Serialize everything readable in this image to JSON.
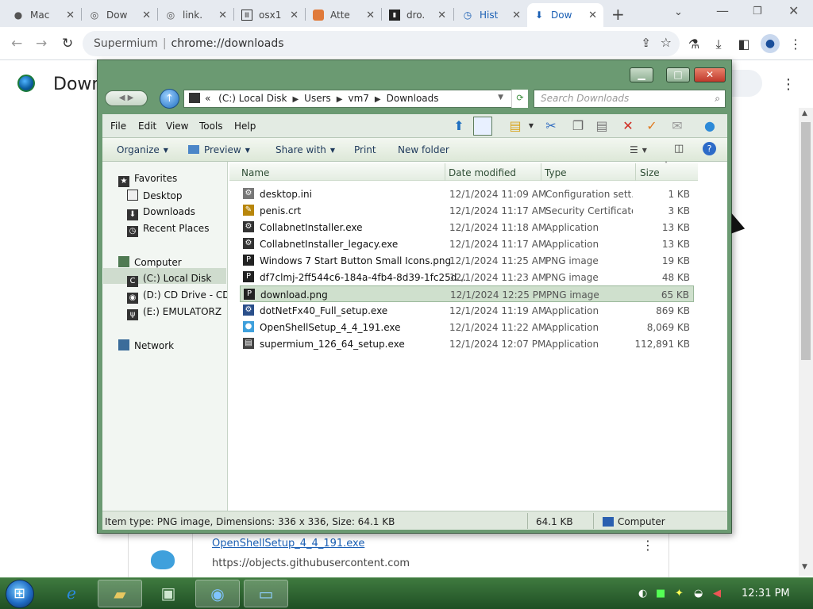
{
  "browser": {
    "tabs": [
      {
        "title": "Mac",
        "icon": "apple-icon"
      },
      {
        "title": "Dow",
        "icon": "globe-icon"
      },
      {
        "title": "link.",
        "icon": "link-icon"
      },
      {
        "title": "osx1",
        "icon": "archive-icon"
      },
      {
        "title": "Atte",
        "icon": "colored-icon"
      },
      {
        "title": "dro.",
        "icon": "terminal-icon"
      },
      {
        "title": "Hist",
        "icon": "history-icon"
      },
      {
        "title": "Dow",
        "icon": "download-icon",
        "active": true
      }
    ],
    "new_tab": "+",
    "tab_menu": "⌄",
    "window_controls": {
      "minimize": "—",
      "restore": "❐",
      "close": "✕"
    },
    "omnibox": {
      "site": "Supermium",
      "url": "chrome://downloads"
    },
    "nav": {
      "back": "←",
      "forward": "→",
      "reload": "↻"
    }
  },
  "downloads_page": {
    "title": "Down",
    "menu": "⋮",
    "card": {
      "link": "OpenShellSetup_4_4_191.exe",
      "url": "https://objects.githubusercontent.com",
      "menu": "⋮"
    }
  },
  "explorer": {
    "caption_buttons": {
      "minimize": "▁",
      "maximize": "□",
      "close": "✕"
    },
    "back_forward": "◀ ▶",
    "up_glyph": "↑",
    "address": {
      "overflow": "«",
      "crumbs": [
        "(C:) Local Disk",
        "Users",
        "vm7",
        "Downloads"
      ],
      "sep": "▶",
      "dropdown": "▼",
      "refresh": "⟳"
    },
    "search": {
      "placeholder": "Search Downloads",
      "icon": "🔍"
    },
    "menu": [
      "File",
      "Edit",
      "View",
      "Tools",
      "Help"
    ],
    "commands": [
      {
        "label": "Organize",
        "dropdown": true
      },
      {
        "label": "Preview",
        "dropdown": true
      },
      {
        "label": "Share with",
        "dropdown": true
      },
      {
        "label": "Print",
        "dropdown": false
      },
      {
        "label": "New folder",
        "dropdown": false
      }
    ],
    "dropdown_glyph": "▼",
    "nav": {
      "favorites": "Favorites",
      "favorites_items": [
        "Desktop",
        "Downloads",
        "Recent Places"
      ],
      "computer": "Computer",
      "computer_items": [
        "(C:) Local Disk",
        "(D:) CD Drive - CDRC",
        "(E:) EMULATORZ"
      ],
      "network": "Network"
    },
    "columns": {
      "name": "Name",
      "date": "Date modified",
      "type": "Type",
      "size": "Size"
    },
    "sort_arrow": "˄",
    "files": [
      {
        "name": "desktop.ini",
        "date": "12/1/2024 11:09 AM",
        "type": "Configuration sett...",
        "size": "1 KB",
        "icon": "settings-file-icon"
      },
      {
        "name": "penis.crt",
        "date": "12/1/2024 11:17 AM",
        "type": "Security Certificate",
        "size": "3 KB",
        "icon": "certificate-icon"
      },
      {
        "name": "CollabnetInstaller.exe",
        "date": "12/1/2024 11:18 AM",
        "type": "Application",
        "size": "13 KB",
        "icon": "application-icon"
      },
      {
        "name": "CollabnetInstaller_legacy.exe",
        "date": "12/1/2024 11:17 AM",
        "type": "Application",
        "size": "13 KB",
        "icon": "application-icon"
      },
      {
        "name": "Windows 7 Start Button Small Icons.png",
        "date": "12/1/2024 11:25 AM",
        "type": "PNG image",
        "size": "19 KB",
        "icon": "png-icon"
      },
      {
        "name": "df7clmj-2ff544c6-184a-4fb4-8d39-1fc25d...",
        "date": "12/1/2024 11:23 AM",
        "type": "PNG image",
        "size": "48 KB",
        "icon": "png-icon"
      },
      {
        "name": "download.png",
        "date": "12/1/2024 12:25 PM",
        "type": "PNG image",
        "size": "65 KB",
        "icon": "png-icon",
        "selected": true
      },
      {
        "name": "dotNetFx40_Full_setup.exe",
        "date": "12/1/2024 11:19 AM",
        "type": "Application",
        "size": "869 KB",
        "icon": "installer-icon"
      },
      {
        "name": "OpenShellSetup_4_4_191.exe",
        "date": "12/1/2024 11:22 AM",
        "type": "Application",
        "size": "8,069 KB",
        "icon": "shell-icon"
      },
      {
        "name": "supermium_126_64_setup.exe",
        "date": "12/1/2024 12:07 PM",
        "type": "Application",
        "size": "112,891 KB",
        "icon": "setup-icon"
      }
    ],
    "status": {
      "details": "Item type: PNG image, Dimensions: 336 x 336, Size: 64.1 KB",
      "size": "64.1 KB",
      "location": "Computer"
    }
  },
  "taskbar": {
    "clock": "12:31 PM",
    "start_glyph": "⊞"
  },
  "colors": {
    "explorer_frame": "#6b9a72",
    "selection": "#cfe0cd",
    "taskbar": "#2f6a35",
    "link": "#1a5fb4"
  }
}
